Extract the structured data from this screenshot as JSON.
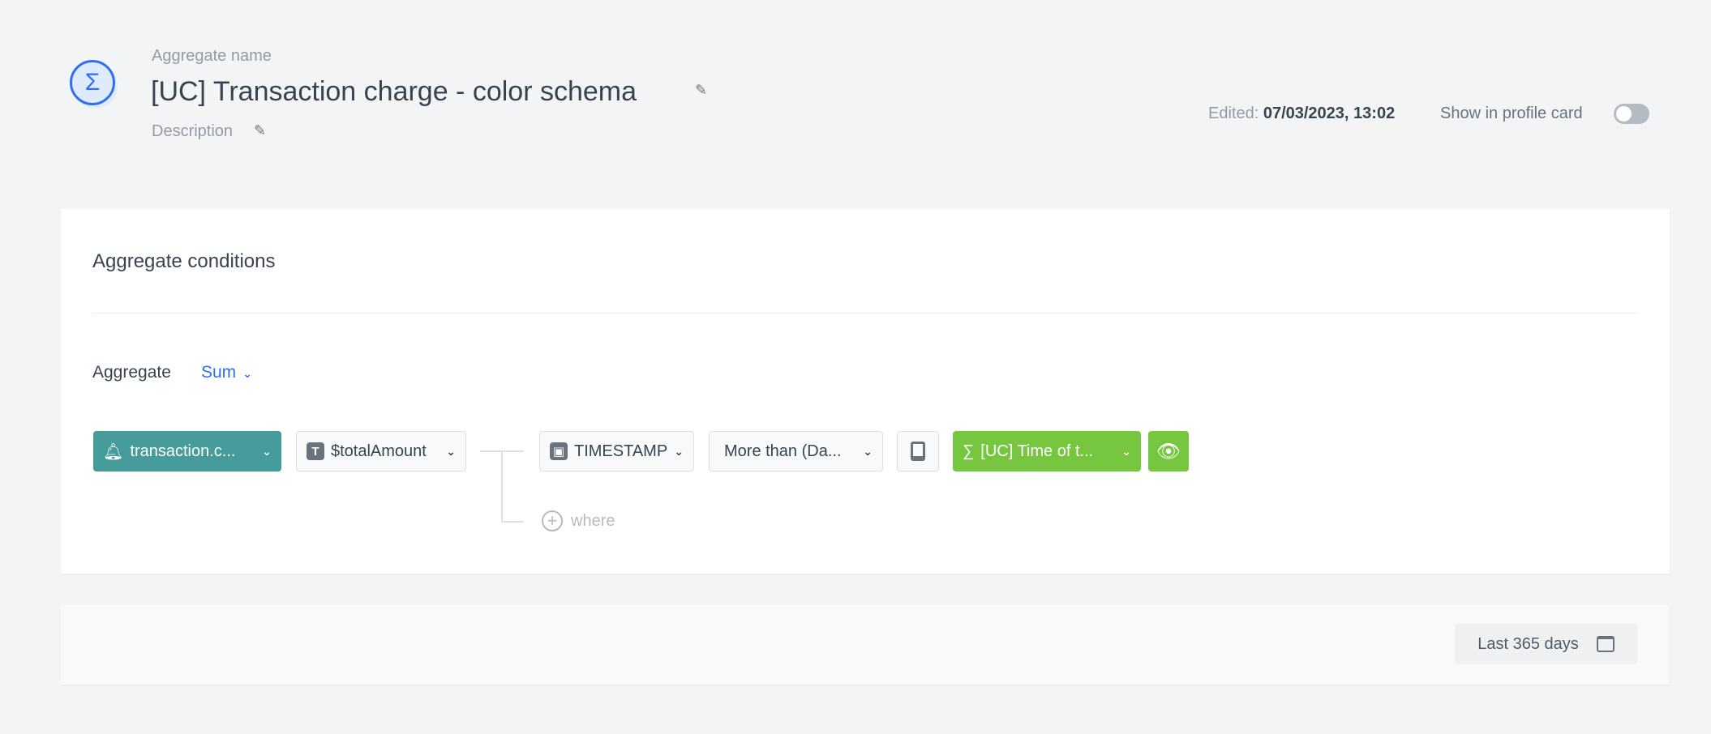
{
  "header": {
    "name_label": "Aggregate name",
    "title": "[UC] Transaction charge - color schema",
    "description_label": "Description",
    "edited_label": "Edited:",
    "edited_value": "07/03/2023, 13:02",
    "show_in_profile_label": "Show in profile card",
    "show_in_profile_on": false,
    "icon": "sigma-icon"
  },
  "conditions": {
    "title": "Aggregate conditions",
    "aggregate_label": "Aggregate",
    "aggregate_value": "Sum",
    "event": "transaction.c...",
    "parameter": "$totalAmount",
    "filter_param": "TIMESTAMP",
    "operator": "More than (Da...",
    "value": "[UC] Time of t...",
    "where_label": "where",
    "colors": {
      "event": "#459c9a",
      "value": "#76c63f",
      "accent": "#2f6ef5"
    }
  },
  "footer": {
    "date_range": "Last 365 days"
  }
}
